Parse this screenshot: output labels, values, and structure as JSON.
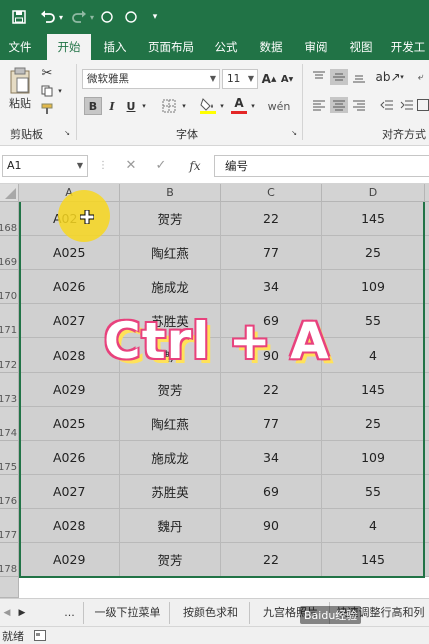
{
  "quick_access": {
    "save_icon": "save-icon",
    "undo_icon": "undo-icon",
    "redo_icon": "redo-icon"
  },
  "tabs": [
    {
      "label": "文件",
      "active": false
    },
    {
      "label": "开始",
      "active": true
    },
    {
      "label": "插入",
      "active": false
    },
    {
      "label": "页面布局",
      "active": false
    },
    {
      "label": "公式",
      "active": false
    },
    {
      "label": "数据",
      "active": false
    },
    {
      "label": "审阅",
      "active": false
    },
    {
      "label": "视图",
      "active": false
    },
    {
      "label": "开发工",
      "active": false
    }
  ],
  "ribbon": {
    "clipboard": {
      "paste_label": "粘贴",
      "group_label": "剪贴板"
    },
    "font": {
      "font_name": "微软雅黑",
      "font_size": "11",
      "bold": "B",
      "italic": "I",
      "underline": "U",
      "grow_font": "A",
      "shrink_font": "A",
      "font_color_letter": "A",
      "group_label": "字体"
    },
    "alignment": {
      "group_label": "对齐方式"
    }
  },
  "formula_bar": {
    "name_box": "A1",
    "cancel": "✕",
    "enter": "✓",
    "fx": "fx",
    "content": "编号"
  },
  "columns": [
    "A",
    "B",
    "C",
    "D"
  ],
  "rows": [
    {
      "num": "168",
      "a": "A02",
      "b": "贺芳",
      "c": "22",
      "d": "145"
    },
    {
      "num": "169",
      "a": "A025",
      "b": "陶红燕",
      "c": "77",
      "d": "25"
    },
    {
      "num": "170",
      "a": "A026",
      "b": "施成龙",
      "c": "34",
      "d": "109"
    },
    {
      "num": "171",
      "a": "A027",
      "b": "苏胜英",
      "c": "69",
      "d": "55"
    },
    {
      "num": "172",
      "a": "A028",
      "b": "魏丹",
      "c": "90",
      "d": "4"
    },
    {
      "num": "173",
      "a": "A029",
      "b": "贺芳",
      "c": "22",
      "d": "145"
    },
    {
      "num": "174",
      "a": "A025",
      "b": "陶红燕",
      "c": "77",
      "d": "25"
    },
    {
      "num": "175",
      "a": "A026",
      "b": "施成龙",
      "c": "34",
      "d": "109"
    },
    {
      "num": "176",
      "a": "A027",
      "b": "苏胜英",
      "c": "69",
      "d": "55"
    },
    {
      "num": "177",
      "a": "A028",
      "b": "魏丹",
      "c": "90",
      "d": "4"
    },
    {
      "num": "178",
      "a": "A029",
      "b": "贺芳",
      "c": "22",
      "d": "145"
    }
  ],
  "overlay": {
    "shortcut_text": "Ctrl + A"
  },
  "sheets": {
    "ellipsis": "...",
    "tabs": [
      "一级下拉菜单",
      "按颜色求和",
      "九宫格照片",
      "快速调整行高和列"
    ]
  },
  "status": {
    "ready": "就绪"
  },
  "watermark": "Baidu经验"
}
